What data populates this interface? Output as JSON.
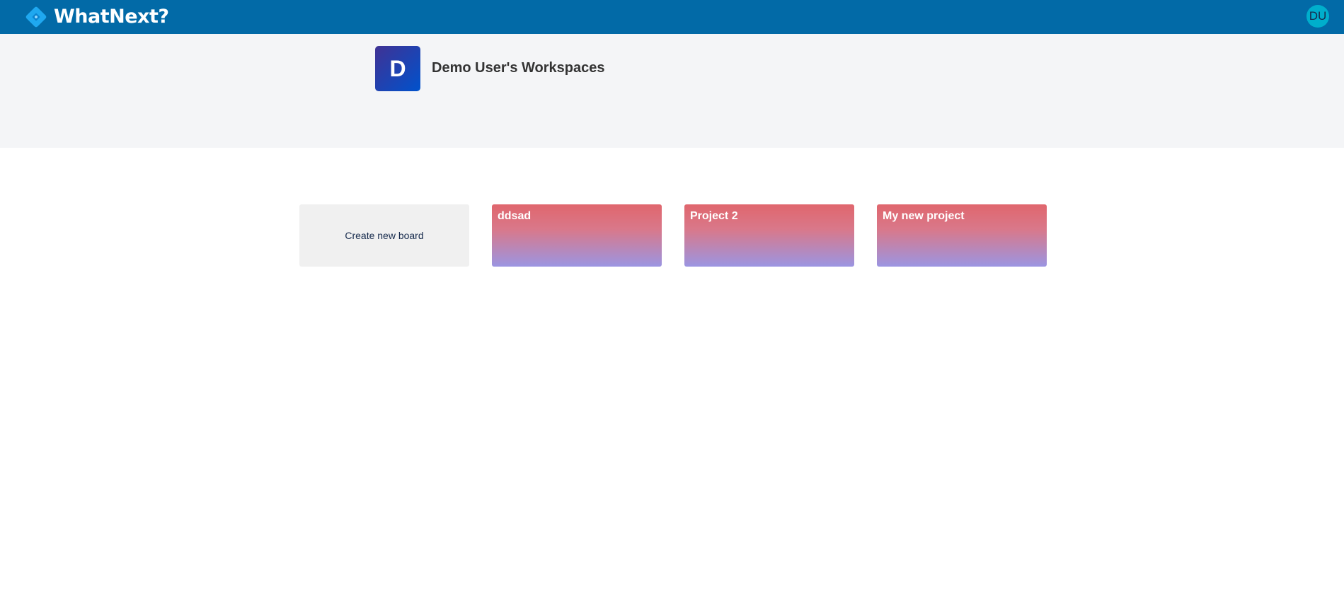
{
  "app": {
    "brand": "WhatNext?",
    "user_initials": "DU"
  },
  "workspace": {
    "badge_letter": "D",
    "title": "Demo User's Workspaces"
  },
  "boards": {
    "create_label": "Create new board",
    "items": [
      {
        "name": "ddsad"
      },
      {
        "name": "Project 2"
      },
      {
        "name": "My new project"
      }
    ]
  },
  "colors": {
    "topbar": "#026aa7",
    "logo_mark": "#1fa8f0",
    "avatar": "#00aecc",
    "workspace_bg": "#f4f5f7",
    "board_gradient_top": "#e0666d",
    "board_gradient_bottom": "#9b95e2"
  }
}
